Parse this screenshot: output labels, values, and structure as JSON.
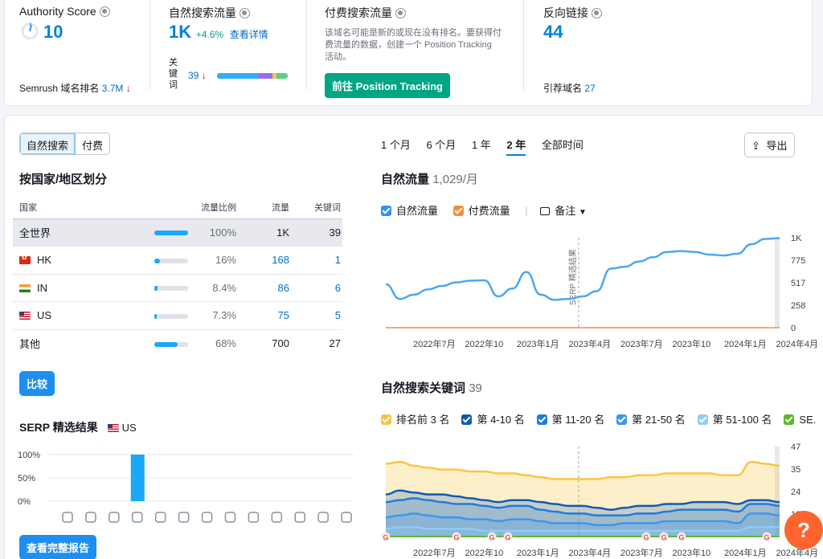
{
  "overview": {
    "authority": {
      "label": "Authority Score",
      "value": "10",
      "rank_label": "Semrush 域名排名",
      "rank_value": "3.7M",
      "rank_arrow": "↓"
    },
    "organic": {
      "label": "自然搜索流量",
      "value": "1K",
      "change": "+4.6%",
      "link": "查看详情",
      "keywords_label": "关键词",
      "keywords_value": "39",
      "keywords_arrow": "↓",
      "kw_distribution": [
        {
          "color": "#29b1f3",
          "share": 0.58
        },
        {
          "color": "#9a6ce8",
          "share": 0.2
        },
        {
          "color": "#f4c542",
          "share": 0.06
        },
        {
          "color": "#5fcd84",
          "share": 0.16
        }
      ]
    },
    "paid": {
      "label": "付费搜索流量",
      "note_line1": "该域名可能是新的或现在没有排名。要获得付",
      "note_line2": "费流量的数据，创建一个 Position Tracking",
      "note_line3": "活动。",
      "button": "前往 Position Tracking"
    },
    "backlinks": {
      "label": "反向链接",
      "value": "44",
      "ref_label": "引荐域名",
      "ref_value": "27"
    }
  },
  "left": {
    "toggle": [
      "自然搜索",
      "付费"
    ],
    "geo_title": "按国家/地区划分",
    "geo_headers": [
      "国家",
      "流量比例",
      "流量",
      "关键词"
    ],
    "geo_rows": [
      {
        "country": "全世界",
        "flag": "",
        "share": "100%",
        "share_frac": 1.0,
        "traffic": "1K",
        "keywords": "39"
      },
      {
        "country": "HK",
        "flag": "hk",
        "share": "16%",
        "share_frac": 0.16,
        "traffic": "168",
        "keywords": "1"
      },
      {
        "country": "IN",
        "flag": "in",
        "share": "8.4%",
        "share_frac": 0.084,
        "traffic": "86",
        "keywords": "6"
      },
      {
        "country": "US",
        "flag": "us",
        "share": "7.3%",
        "share_frac": 0.073,
        "traffic": "75",
        "keywords": "5"
      },
      {
        "country": "其他",
        "flag": "",
        "share": "68%",
        "share_frac": 0.68,
        "traffic": "700",
        "keywords": "27"
      }
    ],
    "compare_button": "比较",
    "serp_title": "SERP 精选结果",
    "serp_country": "US",
    "serp_yticks": [
      "100%",
      "50%",
      "0%"
    ],
    "full_report_button": "查看完整报告"
  },
  "right": {
    "periods": [
      "1 个月",
      "6 个月",
      "1 年",
      "2 年",
      "全部时间"
    ],
    "export": "导出",
    "traffic_title": "自然流量",
    "traffic_value": "1,029/月",
    "traffic_legend": [
      {
        "label": "自然流量",
        "color": "#2d94f6"
      },
      {
        "label": "付费流量",
        "color": "#ff8a3c"
      }
    ],
    "notes_label": "备注",
    "featured_label": "SERP 精选结果",
    "kw_title": "自然搜索关键词",
    "kw_count": "39",
    "kw_legend": [
      {
        "label": "排名前 3 名",
        "color": "#f9c640"
      },
      {
        "label": "第 4-10 名",
        "color": "#0d5bb5"
      },
      {
        "label": "第 11-20 名",
        "color": "#1d7be0"
      },
      {
        "label": "第 21-50 名",
        "color": "#3c97f2"
      },
      {
        "label": "第 51-100 名",
        "color": "#8ecbfa"
      },
      {
        "label": "SE.",
        "color": "#5cb82c"
      }
    ]
  },
  "help": "?",
  "chart_data": [
    {
      "type": "line",
      "title": "自然流量",
      "x": [
        "2022年7月",
        "2022年10",
        "2023年1月",
        "2023年4月",
        "2023年7月",
        "2023年10",
        "2024年1月",
        "2024年4月"
      ],
      "yticks": [
        "1K",
        "775",
        "517",
        "258",
        "0"
      ],
      "ylim": [
        0,
        1034
      ],
      "series": [
        {
          "name": "自然流量",
          "color": "#4aa8f0",
          "values": [
            500,
            330,
            380,
            440,
            480,
            520,
            540,
            545,
            360,
            450,
            640,
            380,
            320,
            330,
            360,
            420,
            680,
            700,
            760,
            810,
            870,
            880,
            870,
            840,
            830,
            850,
            960,
            1020,
            1029
          ]
        },
        {
          "name": "付费流量",
          "color": "#ff8a3c",
          "values": [
            0,
            0,
            0,
            0,
            0,
            0,
            0,
            0,
            0,
            0,
            0,
            0,
            0,
            0,
            0,
            0,
            0,
            0,
            0,
            0,
            0,
            0,
            0,
            0,
            0,
            0,
            0,
            0,
            0
          ]
        }
      ]
    },
    {
      "type": "area",
      "title": "自然搜索关键词",
      "x": [
        "2022年7月",
        "2022年10",
        "2023年1月",
        "2023年4月",
        "2023年7月",
        "2023年10",
        "2024年1月",
        "2024年4月"
      ],
      "yticks": [
        "47",
        "35",
        "24",
        "12"
      ],
      "ylim": [
        0,
        47
      ],
      "series": [
        {
          "name": "排名前 3 名",
          "values": [
            38,
            39,
            37,
            36,
            35,
            35,
            34,
            34,
            33,
            33,
            32,
            31,
            30,
            30,
            30,
            30,
            31,
            31,
            32,
            32,
            33,
            33,
            33,
            33,
            32,
            32,
            39,
            38,
            37
          ]
        },
        {
          "name": "第 4-10 名",
          "values": [
            22,
            24,
            23,
            22,
            22,
            21,
            20,
            19,
            18,
            19,
            19,
            18,
            17,
            16,
            16,
            15,
            14,
            15,
            16,
            16,
            17,
            17,
            18,
            18,
            18,
            17,
            19,
            19,
            18
          ]
        },
        {
          "name": "第 11-20 名",
          "values": [
            18,
            19,
            20,
            19,
            18,
            17,
            17,
            16,
            15,
            16,
            16,
            14,
            13,
            12,
            12,
            11,
            11,
            11,
            12,
            12,
            13,
            14,
            14,
            14,
            14,
            13,
            17,
            17,
            16
          ]
        },
        {
          "name": "第 21-50 名",
          "values": [
            10,
            11,
            12,
            11,
            10,
            10,
            9,
            9,
            8,
            9,
            9,
            8,
            7,
            7,
            7,
            6,
            6,
            7,
            7,
            7,
            8,
            8,
            8,
            8,
            8,
            7,
            12,
            12,
            11
          ]
        },
        {
          "name": "第 51-100 名",
          "values": [
            4,
            5,
            5,
            4,
            4,
            4,
            4,
            3,
            3,
            3,
            3,
            3,
            3,
            3,
            3,
            3,
            3,
            3,
            3,
            3,
            3,
            3,
            3,
            3,
            3,
            3,
            5,
            5,
            5
          ]
        }
      ]
    },
    {
      "type": "bar",
      "title": "SERP 精选结果",
      "categories": [
        "ai-overview",
        "link",
        "star",
        "image",
        "video",
        "video-carousel",
        "video-2",
        "faq",
        "local-pack",
        "knowledge",
        "news",
        "jobs",
        "x-post"
      ],
      "values": [
        0,
        0,
        0,
        100,
        0,
        0,
        0,
        0,
        0,
        0,
        0,
        0,
        0
      ],
      "ylim": [
        0,
        100
      ]
    }
  ]
}
